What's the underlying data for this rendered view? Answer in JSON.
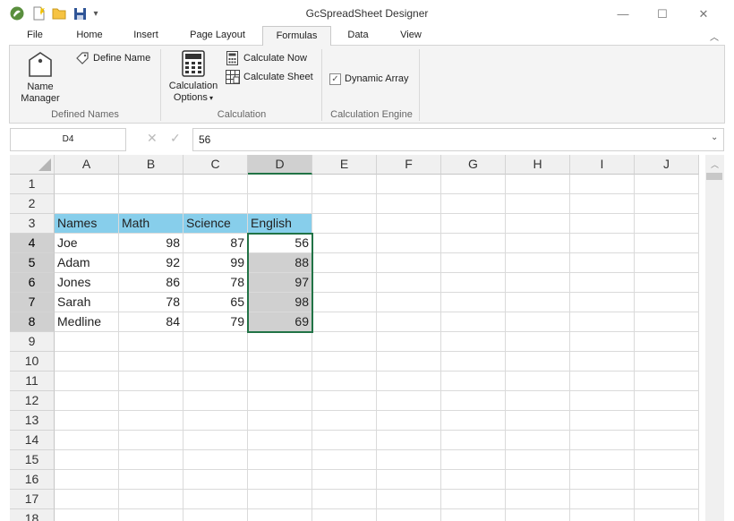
{
  "window": {
    "title": "GcSpreadSheet Designer",
    "minimize": "—",
    "maximize": "☐",
    "close": "✕"
  },
  "tabs": [
    {
      "label": "File"
    },
    {
      "label": "Home"
    },
    {
      "label": "Insert"
    },
    {
      "label": "Page Layout"
    },
    {
      "label": "Formulas",
      "active": true
    },
    {
      "label": "Data"
    },
    {
      "label": "View"
    }
  ],
  "ribbon": {
    "defined_names": {
      "name_manager_line1": "Name",
      "name_manager_line2": "Manager",
      "define_name": "Define Name",
      "group_label": "Defined Names"
    },
    "calculation": {
      "options_line1": "Calculation",
      "options_line2": "Options",
      "calc_now": "Calculate Now",
      "calc_sheet": "Calculate Sheet",
      "group_label": "Calculation"
    },
    "engine": {
      "dynamic_array": "Dynamic Array",
      "dynamic_array_checked": true,
      "group_label": "Calculation Engine"
    }
  },
  "formula_bar": {
    "name_box": "D4",
    "value": "56"
  },
  "grid": {
    "columns": [
      "A",
      "B",
      "C",
      "D",
      "E",
      "F",
      "G",
      "H",
      "I",
      "J"
    ],
    "rows": [
      "1",
      "2",
      "3",
      "4",
      "5",
      "6",
      "7",
      "8",
      "9",
      "10",
      "11",
      "12",
      "13",
      "14",
      "15",
      "16",
      "17",
      "18"
    ],
    "headers": [
      "Names",
      "Math",
      "Science",
      "English"
    ],
    "data": [
      [
        "Joe",
        "98",
        "87",
        "56"
      ],
      [
        "Adam",
        "92",
        "99",
        "88"
      ],
      [
        "Jones",
        "86",
        "78",
        "97"
      ],
      [
        "Sarah",
        "78",
        "65",
        "98"
      ],
      [
        "Medline",
        "84",
        "79",
        "69"
      ]
    ],
    "active_cell": "D4",
    "selection": "D4:D8",
    "header_fill": "#87ceeb",
    "accent": "#217346"
  }
}
